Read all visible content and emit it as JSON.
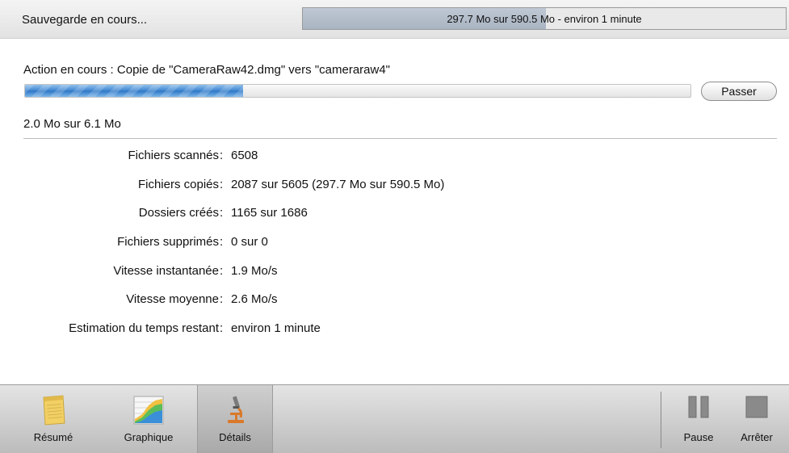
{
  "header": {
    "title": "Sauvegarde en cours...",
    "overall_progress_text": "297.7 Mo sur 590.5 Mo - environ 1 minute",
    "overall_progress_fraction": 0.504
  },
  "current": {
    "action_text": "Action en cours : Copie de \"CameraRaw42.dmg\" vers \"cameraraw4\"",
    "file_progress_fraction": 0.328,
    "skip_label": "Passer",
    "size_text": "2.0 Mo sur 6.1 Mo"
  },
  "stats": {
    "separator": ":",
    "rows": [
      {
        "label": "Fichiers scannés",
        "value": "6508"
      },
      {
        "label": "Fichiers copiés",
        "value": "2087 sur 5605 (297.7 Mo sur 590.5 Mo)"
      },
      {
        "label": "Dossiers créés",
        "value": "1165 sur 1686"
      },
      {
        "label": "Fichiers supprimés",
        "value": "0 sur 0"
      },
      {
        "label": "Vitesse instantanée",
        "value": "1.9 Mo/s"
      },
      {
        "label": "Vitesse moyenne",
        "value": "2.6 Mo/s"
      },
      {
        "label": "Estimation du temps restant",
        "value": "environ 1 minute"
      }
    ]
  },
  "toolbar": {
    "summary_label": "Résumé",
    "summary_icon": "notepad-icon",
    "graph_label": "Graphique",
    "graph_icon": "area-chart-icon",
    "details_label": "Détails",
    "details_icon": "microscope-icon",
    "selected": "details",
    "pause_label": "Pause",
    "pause_icon": "pause-icon",
    "stop_label": "Arrêter",
    "stop_icon": "stop-icon"
  },
  "colors": {
    "progress_blue": "#3b83cf",
    "toolbar_gray": "#c8c8c8",
    "notepad_yellow": "#f2d064"
  }
}
